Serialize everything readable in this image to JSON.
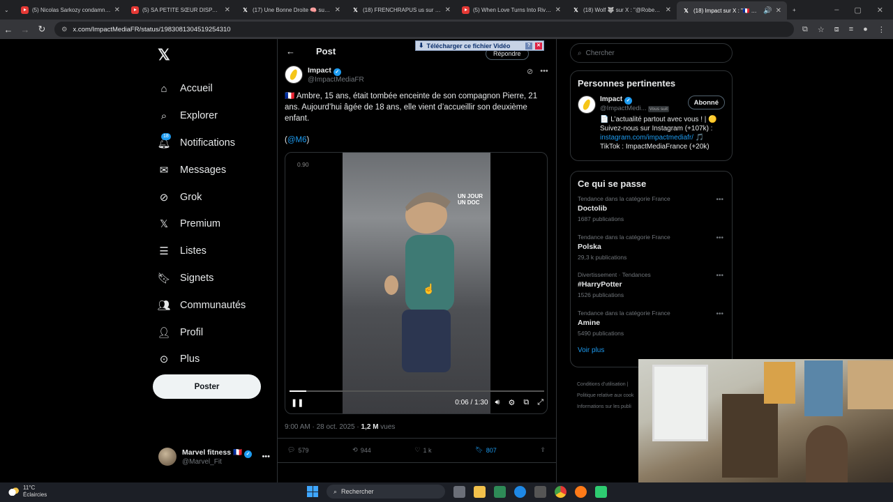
{
  "browser": {
    "tabs": [
      {
        "icon": "youtube-icon",
        "title": "(5) Nicolas Sarkozy condamné..."
      },
      {
        "icon": "youtube-icon",
        "title": "(5) SA PETITE SŒUR DISPARAÎT"
      },
      {
        "icon": "x-icon",
        "title": "(17) Une Bonne Droite 🧠 sur X"
      },
      {
        "icon": "x-icon",
        "title": "(18) FRENCHRAPUS us sur X : \""
      },
      {
        "icon": "youtube-icon",
        "title": "(5) When Love Turns Into Rivalr"
      },
      {
        "icon": "x-icon",
        "title": "(18) Wolf 🐺 sur X : \"@RobertH"
      },
      {
        "icon": "x-icon",
        "title": "(18) Impact sur X : \"🇫🇷 Amb"
      }
    ],
    "url": "x.com/ImpactMediaFR/status/1983081304519254310"
  },
  "nav": {
    "items": [
      {
        "icon": "home-icon",
        "label": "Accueil"
      },
      {
        "icon": "search-icon",
        "label": "Explorer"
      },
      {
        "icon": "bell-icon",
        "label": "Notifications",
        "badge": "18"
      },
      {
        "icon": "mail-icon",
        "label": "Messages"
      },
      {
        "icon": "grok-icon",
        "label": "Grok"
      },
      {
        "icon": "x-icon",
        "label": "Premium"
      },
      {
        "icon": "list-icon",
        "label": "Listes"
      },
      {
        "icon": "bookmark-icon",
        "label": "Signets"
      },
      {
        "icon": "communities-icon",
        "label": "Communautés"
      },
      {
        "icon": "profile-icon",
        "label": "Profil"
      },
      {
        "icon": "more-icon",
        "label": "Plus"
      }
    ],
    "post_button": "Poster",
    "account": {
      "name": "Marvel fitness 🇫🇷",
      "handle": "@Marvel_Fit"
    }
  },
  "post": {
    "header": "Post",
    "reply_button": "Répondre",
    "download_bar": "Télécharger ce fichier Vidéo",
    "author": {
      "name": "Impact",
      "handle": "@ImpactMediaFR"
    },
    "text": "🇫🇷 Ambre, 15 ans, était tombée enceinte de son compagnon Pierre, 21 ans. Aujourd’hui âgée de 18 ans, elle vient d’accueillir son deuxième enfant.",
    "mention": "@M6",
    "video": {
      "watermark_line1": "UN JOUR",
      "watermark_line2": "UN DOC",
      "rate": "0.90",
      "time": "0:06 / 1:30",
      "progress": 0.067
    },
    "timestamp": "9:00 AM · 28 oct. 2025 · ",
    "views_count": "1,2 M",
    "views_label": " vues",
    "stats": {
      "replies": "579",
      "reposts": "944",
      "likes": "1 k",
      "bookmarks": "807"
    }
  },
  "sidebar": {
    "search_placeholder": "Chercher",
    "relevant": {
      "title": "Personnes pertinentes",
      "name": "Impact",
      "handle": "@ImpactMedi...",
      "follows_you": "Vous suit",
      "follow_button": "Abonné",
      "bio_line1": "📄 L’actualité partout avec vous ! | 🟡",
      "bio_line2": "Suivez-nous sur Instagram (+107k) :",
      "bio_link": "instagram.com/impactmediafr/",
      "bio_line3": "TikTok : ImpactMediaFrance (+20k)"
    },
    "trends": {
      "title": "Ce qui se passe",
      "items": [
        {
          "category": "Tendance dans la catégorie France",
          "name": "Doctolib",
          "count": "1687 publications"
        },
        {
          "category": "Tendance dans la catégorie France",
          "name": "Polska",
          "count": "29,3 k publications"
        },
        {
          "category": "Divertissement · Tendances",
          "name": "#HarryPotter",
          "count": "1526 publications"
        },
        {
          "category": "Tendance dans la catégorie France",
          "name": "Amine",
          "count": "5490 publications"
        }
      ],
      "more": "Voir plus"
    },
    "footer": [
      "Conditions d’utilisation |",
      "Politique relative aux cook",
      "Informations sur les publi"
    ]
  },
  "taskbar": {
    "temp": "11°C",
    "weather": "Éclaircies",
    "search": "Rechercher"
  }
}
